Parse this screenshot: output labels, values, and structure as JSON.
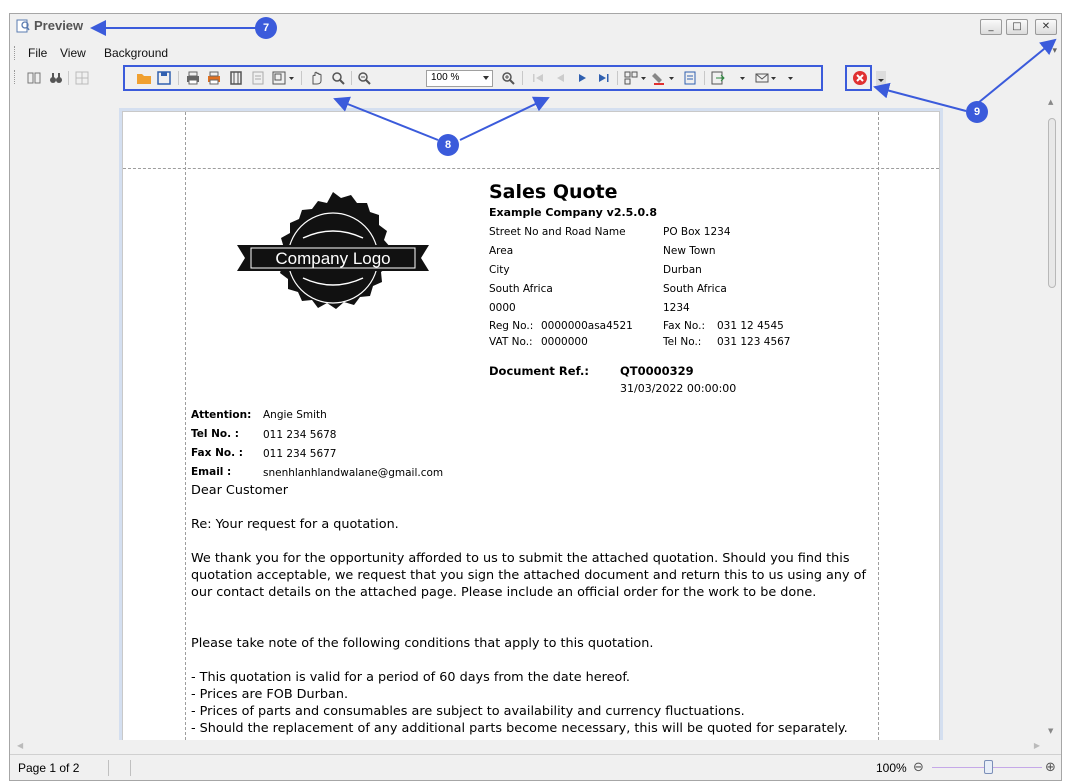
{
  "window": {
    "title": "Preview",
    "buttons": [
      "_",
      "□",
      "✕"
    ]
  },
  "menu": {
    "items": [
      "File",
      "View",
      "Background"
    ]
  },
  "toolbar": {
    "zoom_value": "100 %",
    "icons": [
      "show-hide-thumbnails-icon",
      "find-icon",
      "multi-page-icon",
      "open-icon",
      "save-icon",
      "print-icon",
      "quick-print-icon",
      "page-setup-icon",
      "scale-icon",
      "hand-tool-icon",
      "magnifier-icon",
      "zoom-out-icon",
      "zoom-in-icon",
      "first-page-icon",
      "previous-page-icon",
      "next-page-icon",
      "last-page-icon",
      "multiple-pages-icon",
      "background-color-icon",
      "watermark-icon",
      "export-icon",
      "send-email-icon",
      "close-preview-icon"
    ]
  },
  "callouts": {
    "c7": "7",
    "c8": "8",
    "c9": "9"
  },
  "document": {
    "logo_text": "Company Logo",
    "title": "Sales Quote",
    "company": "Example Company v2.5.0.8",
    "address_left": [
      "Street No and Road Name",
      "Area",
      "City",
      "South Africa",
      "0000"
    ],
    "address_right": [
      "PO Box 1234",
      "New Town",
      "Durban",
      "South Africa",
      "1234"
    ],
    "reg_label": "Reg No.:",
    "reg_value": "0000000asa4521",
    "vat_label": "VAT No.:",
    "vat_value": "0000000",
    "fax_label": "Fax No.:",
    "fax_value": "031 12 4545",
    "tel_label": "Tel No.:",
    "tel_value": "031 123 4567",
    "docref_label": "Document Ref.:",
    "docref_value": "QT0000329",
    "doc_date": "31/03/2022 00:00:00",
    "attention_label": "Attention:",
    "attention_value": "Angie Smith",
    "contact_tel_label": "Tel No. :",
    "contact_tel_value": "011 234 5678",
    "contact_fax_label": "Fax No. :",
    "contact_fax_value": "011 234 5677",
    "email_label": "Email :",
    "email_value": "snenhlanhlandwalane@gmail.com",
    "salutation": "Dear Customer",
    "re_line": "Re: Your request for a quotation.",
    "paragraph1": "We thank you for the opportunity afforded to us to submit the attached quotation. Should you find this quotation acceptable, we request that you sign the attached document and return this to us using any of our contact details on the attached page. Please include an official order for the work to be done.",
    "paragraph2": "Please take note of the following conditions that apply to this quotation.",
    "conditions": [
      "- This quotation is valid for a period of 60 days from the date hereof.",
      "- Prices are FOB Durban.",
      "- Prices of parts and consumables are subject to availability and currency fluctuations.",
      "- Should the replacement of any additional parts become necessary, this will be quoted for separately."
    ]
  },
  "status": {
    "page": "Page 1 of 2",
    "zoom": "100%"
  },
  "colors": {
    "callout": "#3b5bdb",
    "close_icon": "#e03131"
  }
}
